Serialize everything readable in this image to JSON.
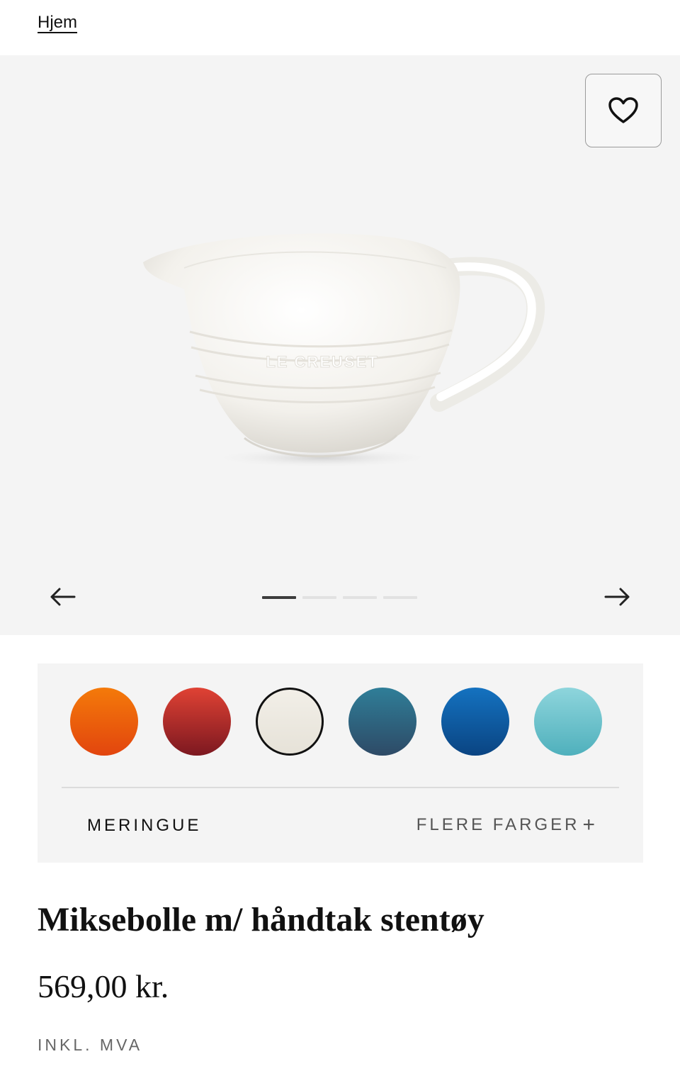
{
  "breadcrumb": {
    "home_label": "Hjem"
  },
  "gallery": {
    "favorite_icon": "heart-icon",
    "prev_icon": "arrow-left-icon",
    "next_icon": "arrow-right-icon",
    "image_count": 4,
    "active_index": 0
  },
  "colors": {
    "selected_name": "MERINGUE",
    "more_label": "FLERE FARGER",
    "more_icon": "plus-icon",
    "swatches": [
      {
        "color_top": "#f47a0a",
        "color_bottom": "#e2450e",
        "selected": false
      },
      {
        "color_top": "#e04234",
        "color_bottom": "#7c1820",
        "selected": false
      },
      {
        "color_top": "#f2efe8",
        "color_bottom": "#e6e2d8",
        "selected": true
      },
      {
        "color_top": "#2f7e98",
        "color_bottom": "#2e4a66",
        "selected": false
      },
      {
        "color_top": "#1472c0",
        "color_bottom": "#0a4482",
        "selected": false
      },
      {
        "color_top": "#8ed5dc",
        "color_bottom": "#4fb0bc",
        "selected": false
      }
    ]
  },
  "product": {
    "title": "Miksebolle m/ håndtak stentøy",
    "price": "569,00 kr.",
    "vat_label": "INKL. MVA",
    "logo_text": "LE CREUSET"
  }
}
